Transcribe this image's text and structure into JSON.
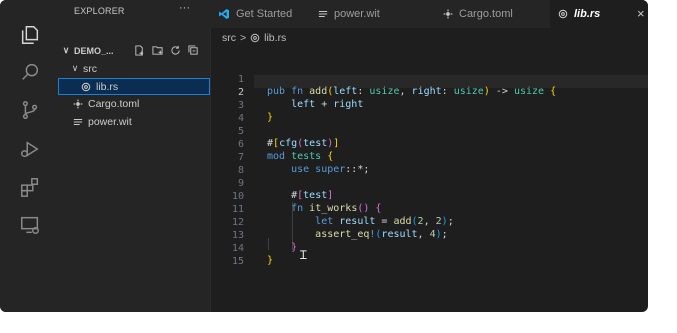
{
  "colors": {
    "accent": "#0b2d52",
    "brand_vscode": "#23a9f2"
  },
  "activity_bar": {
    "icons": [
      "explorer-icon",
      "search-icon",
      "source-control-icon",
      "run-debug-icon",
      "extensions-icon",
      "remote-explorer-icon"
    ]
  },
  "sidebar": {
    "title": "EXPLORER",
    "more": "···",
    "root": "DEMO_...",
    "items": [
      {
        "label": "src",
        "type": "folder",
        "expanded": true
      },
      {
        "label": "lib.rs",
        "type": "rust-file",
        "selected": true
      },
      {
        "label": "Cargo.toml",
        "type": "gear-file"
      },
      {
        "label": "power.wit",
        "type": "text-file"
      }
    ]
  },
  "tabs": [
    {
      "label": "Get Started",
      "icon": "vscode-logo-icon",
      "active": false
    },
    {
      "label": "power.wit",
      "icon": "lines-icon",
      "active": false
    },
    {
      "label": "Cargo.toml",
      "icon": "gear-icon",
      "active": false
    },
    {
      "label": "lib.rs",
      "icon": "rust-icon",
      "active": true
    }
  ],
  "tab_close": "×",
  "breadcrumb": {
    "folder": "src",
    "sep": ">",
    "file": "lib.rs"
  },
  "editor": {
    "current_line": 2,
    "line_numbers": [
      "1",
      "2",
      "3",
      "4",
      "5",
      "6",
      "7",
      "8",
      "9",
      "10",
      "11",
      "12",
      "13",
      "14",
      "15"
    ]
  }
}
